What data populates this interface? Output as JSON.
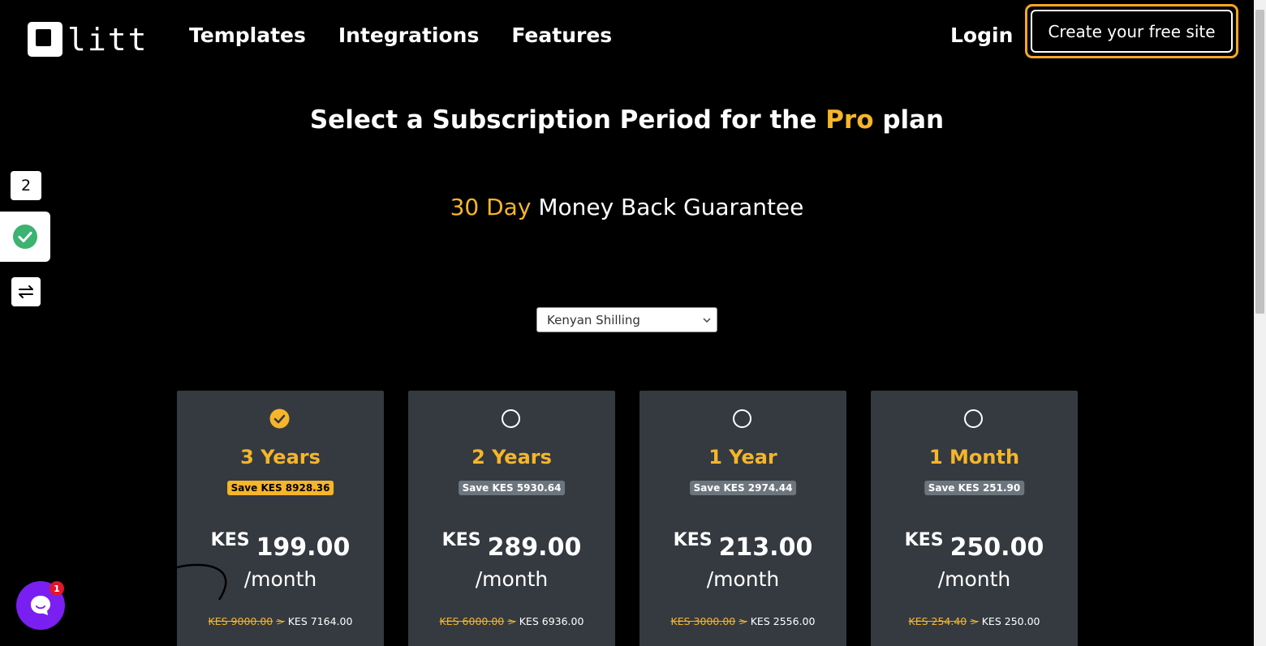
{
  "header": {
    "logo_text": "litt",
    "nav": [
      "Templates",
      "Integrations",
      "Features"
    ],
    "login": "Login",
    "cta": "Create your free site"
  },
  "sidebar_widgets": {
    "counter": "2",
    "check_color": "#3cb371"
  },
  "page": {
    "title_prefix": "Select a Subscription Period for the",
    "title_accent": "Pro",
    "title_suffix": "plan",
    "guarantee_accent": "30 Day",
    "guarantee_rest": "Money Back Guarantee",
    "currency_selected": "Kenyan Shilling"
  },
  "plans": [
    {
      "name": "3 Years",
      "save": "Save KES 8928.36",
      "currency": "KES",
      "price": "199.00",
      "per": "/month",
      "old_total": "KES 9000.00",
      "new_total": "KES 7164.00",
      "selected": true
    },
    {
      "name": "2 Years",
      "save": "Save KES 5930.64",
      "currency": "KES",
      "price": "289.00",
      "per": "/month",
      "old_total": "KES 6000.00",
      "new_total": "KES 6936.00",
      "selected": false
    },
    {
      "name": "1 Year",
      "save": "Save KES 2974.44",
      "currency": "KES",
      "price": "213.00",
      "per": "/month",
      "old_total": "KES 3000.00",
      "new_total": "KES 2556.00",
      "selected": false
    },
    {
      "name": "1 Month",
      "save": "Save KES 251.90",
      "currency": "KES",
      "price": "250.00",
      "per": "/month",
      "old_total": "KES 254.40",
      "new_total": "KES 250.00",
      "selected": false
    }
  ],
  "chat": {
    "badge": "1"
  },
  "colors": {
    "accent": "#f6b52a",
    "card": "#343a40",
    "chat": "#7a1ff2"
  }
}
